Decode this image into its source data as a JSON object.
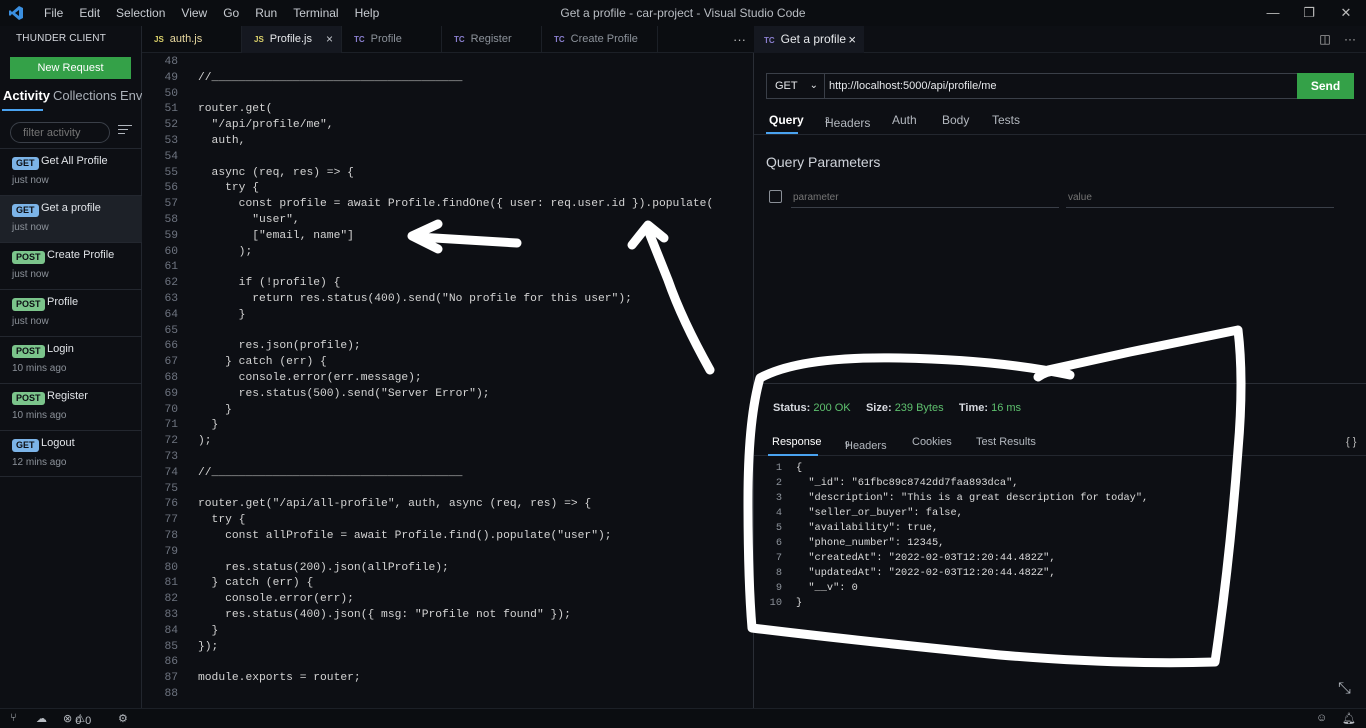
{
  "window": {
    "title": "Get a profile - car-project - Visual Studio Code"
  },
  "menu": [
    "File",
    "Edit",
    "Selection",
    "View",
    "Go",
    "Run",
    "Terminal",
    "Help"
  ],
  "sidebar": {
    "header": "THUNDER CLIENT",
    "new_request": "New Request",
    "tabs": [
      "Activity",
      "Collections",
      "Env"
    ],
    "filter_placeholder": "filter activity",
    "items": [
      {
        "method": "GET",
        "name": "Get All Profile",
        "time": "just now"
      },
      {
        "method": "GET",
        "name": "Get a profile",
        "time": "just now"
      },
      {
        "method": "POST",
        "name": "Create Profile",
        "time": "just now"
      },
      {
        "method": "POST",
        "name": "Profile",
        "time": "just now"
      },
      {
        "method": "POST",
        "name": "Login",
        "time": "10 mins ago"
      },
      {
        "method": "POST",
        "name": "Register",
        "time": "10 mins ago"
      },
      {
        "method": "GET",
        "name": "Logout",
        "time": "12 mins ago"
      }
    ]
  },
  "editor": {
    "tabs": [
      {
        "icon": "JS",
        "label": "auth.js"
      },
      {
        "icon": "JS",
        "label": "Profile.js",
        "close": "×"
      },
      {
        "icon": "TC",
        "label": "Profile"
      },
      {
        "icon": "TC",
        "label": "Register"
      },
      {
        "icon": "TC",
        "label": "Create Profile"
      }
    ],
    "more": "···",
    "code": [
      {
        "n": "48",
        "t": ""
      },
      {
        "n": "49",
        "t": "//_____________________________________"
      },
      {
        "n": "50",
        "t": ""
      },
      {
        "n": "51",
        "t": "router.get("
      },
      {
        "n": "52",
        "t": "  \"/api/profile/me\","
      },
      {
        "n": "53",
        "t": "  auth,"
      },
      {
        "n": "54",
        "t": ""
      },
      {
        "n": "55",
        "t": "  async (req, res) => {"
      },
      {
        "n": "56",
        "t": "    try {"
      },
      {
        "n": "57",
        "t": "      const profile = await Profile.findOne({ user: req.user.id }).populate("
      },
      {
        "n": "58",
        "t": "        \"user\","
      },
      {
        "n": "59",
        "t": "        [\"email, name\"]"
      },
      {
        "n": "60",
        "t": "      );"
      },
      {
        "n": "61",
        "t": ""
      },
      {
        "n": "62",
        "t": "      if (!profile) {"
      },
      {
        "n": "63",
        "t": "        return res.status(400).send(\"No profile for this user\");"
      },
      {
        "n": "64",
        "t": "      }"
      },
      {
        "n": "65",
        "t": ""
      },
      {
        "n": "66",
        "t": "      res.json(profile);"
      },
      {
        "n": "67",
        "t": "    } catch (err) {"
      },
      {
        "n": "68",
        "t": "      console.error(err.message);"
      },
      {
        "n": "69",
        "t": "      res.status(500).send(\"Server Error\");"
      },
      {
        "n": "70",
        "t": "    }"
      },
      {
        "n": "71",
        "t": "  }"
      },
      {
        "n": "72",
        "t": ");"
      },
      {
        "n": "73",
        "t": ""
      },
      {
        "n": "74",
        "t": "//_____________________________________"
      },
      {
        "n": "75",
        "t": ""
      },
      {
        "n": "76",
        "t": "router.get(\"/api/all-profile\", auth, async (req, res) => {"
      },
      {
        "n": "77",
        "t": "  try {"
      },
      {
        "n": "78",
        "t": "    const allProfile = await Profile.find().populate(\"user\");"
      },
      {
        "n": "79",
        "t": ""
      },
      {
        "n": "80",
        "t": "    res.status(200).json(allProfile);"
      },
      {
        "n": "81",
        "t": "  } catch (err) {"
      },
      {
        "n": "82",
        "t": "    console.error(err);"
      },
      {
        "n": "83",
        "t": "    res.status(400).json({ msg: \"Profile not found\" });"
      },
      {
        "n": "84",
        "t": "  }"
      },
      {
        "n": "85",
        "t": "});"
      },
      {
        "n": "86",
        "t": ""
      },
      {
        "n": "87",
        "t": "module.exports = router;"
      },
      {
        "n": "88",
        "t": ""
      }
    ]
  },
  "request": {
    "tab_icon": "TC",
    "tab_label": "Get a profile",
    "tab_close": "×",
    "method": "GET",
    "url": "http://localhost:5000/api/profile/me",
    "send": "Send",
    "tabs": [
      "Query",
      "Headers",
      "Auth",
      "Body",
      "Tests"
    ],
    "headers_count": "3",
    "query_title": "Query Parameters",
    "param_placeholder": "parameter",
    "value_placeholder": "value"
  },
  "response": {
    "status_label": "Status:",
    "status_value": "200 OK",
    "size_label": "Size:",
    "size_value": "239 Bytes",
    "time_label": "Time:",
    "time_value": "16 ms",
    "tabs": [
      "Response",
      "Headers",
      "Cookies",
      "Test Results"
    ],
    "headers_count": "9",
    "braces_icon": "{ }",
    "json": [
      {
        "n": "1",
        "t": "{"
      },
      {
        "n": "2",
        "t": "  \"_id\": \"61fbc89c8742dd7faa893dca\","
      },
      {
        "n": "3",
        "t": "  \"description\": \"This is a great description for today\","
      },
      {
        "n": "4",
        "t": "  \"seller_or_buyer\": false,"
      },
      {
        "n": "5",
        "t": "  \"availability\": true,"
      },
      {
        "n": "6",
        "t": "  \"phone_number\": 12345,"
      },
      {
        "n": "7",
        "t": "  \"createdAt\": \"2022-02-03T12:20:44.482Z\","
      },
      {
        "n": "8",
        "t": "  \"updatedAt\": \"2022-02-03T12:20:44.482Z\","
      },
      {
        "n": "9",
        "t": "  \"__v\": 0"
      },
      {
        "n": "10",
        "t": "}"
      }
    ]
  },
  "statusbar": {
    "errors": "0",
    "warnings": "0"
  },
  "colors": {
    "accent_green": "#34a148",
    "link_blue": "#4aa3f0",
    "annotation": "#ffffff"
  }
}
